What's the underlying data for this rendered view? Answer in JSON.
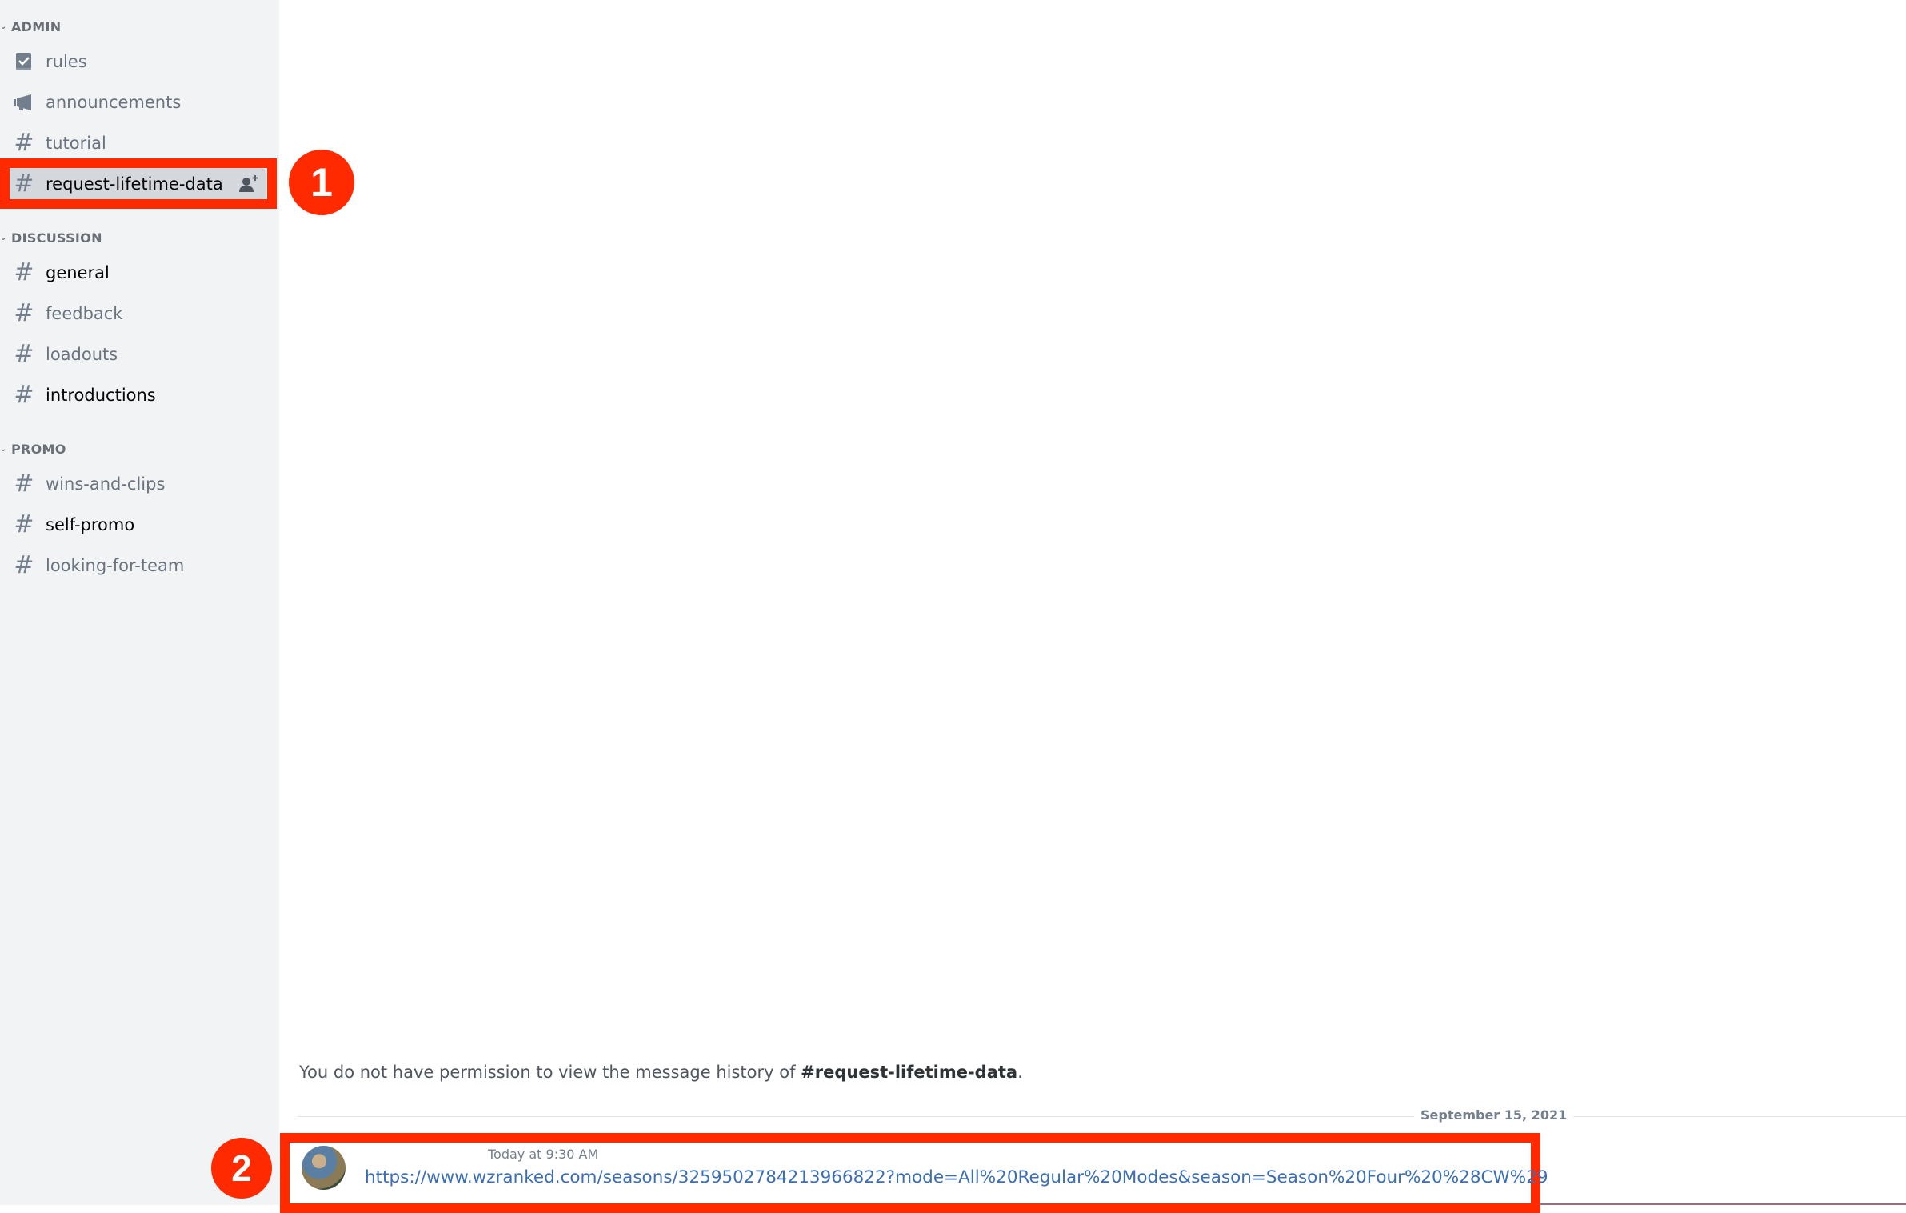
{
  "sidebar": {
    "categories": [
      {
        "label": "ADMIN",
        "channels": [
          {
            "name": "rules",
            "icon": "rules-checkbook-icon",
            "state": "muted"
          },
          {
            "name": "announcements",
            "icon": "megaphone-icon",
            "state": "muted"
          },
          {
            "name": "tutorial",
            "icon": "hash-icon",
            "state": "muted"
          },
          {
            "name": "request-lifetime-data",
            "icon": "hash-icon",
            "state": "selected",
            "action_icon": "add-member-icon"
          }
        ]
      },
      {
        "label": "DISCUSSION",
        "channels": [
          {
            "name": "general",
            "icon": "hash-icon",
            "state": "unread"
          },
          {
            "name": "feedback",
            "icon": "hash-icon",
            "state": "muted"
          },
          {
            "name": "loadouts",
            "icon": "hash-icon",
            "state": "muted"
          },
          {
            "name": "introductions",
            "icon": "hash-icon",
            "state": "unread"
          }
        ]
      },
      {
        "label": "PROMO",
        "channels": [
          {
            "name": "wins-and-clips",
            "icon": "hash-icon",
            "state": "muted"
          },
          {
            "name": "self-promo",
            "icon": "hash-icon",
            "state": "unread"
          },
          {
            "name": "looking-for-team",
            "icon": "hash-icon",
            "state": "muted"
          }
        ]
      }
    ]
  },
  "main": {
    "permission_notice": {
      "prefix": "You do not have permission to view the message history of ",
      "channel": "#request-lifetime-data",
      "suffix": "."
    },
    "date_divider": "September 15, 2021",
    "message": {
      "username": "",
      "timestamp": "Today at 9:30 AM",
      "link": "https://www.wzranked.com/seasons/3259502784213966822?mode=All%20Regular%20Modes&season=Season%20Four%20%28CW%29"
    }
  },
  "annotations": [
    {
      "number": "1",
      "color": "#ff2a00"
    },
    {
      "number": "2",
      "color": "#ff2a00"
    }
  ]
}
